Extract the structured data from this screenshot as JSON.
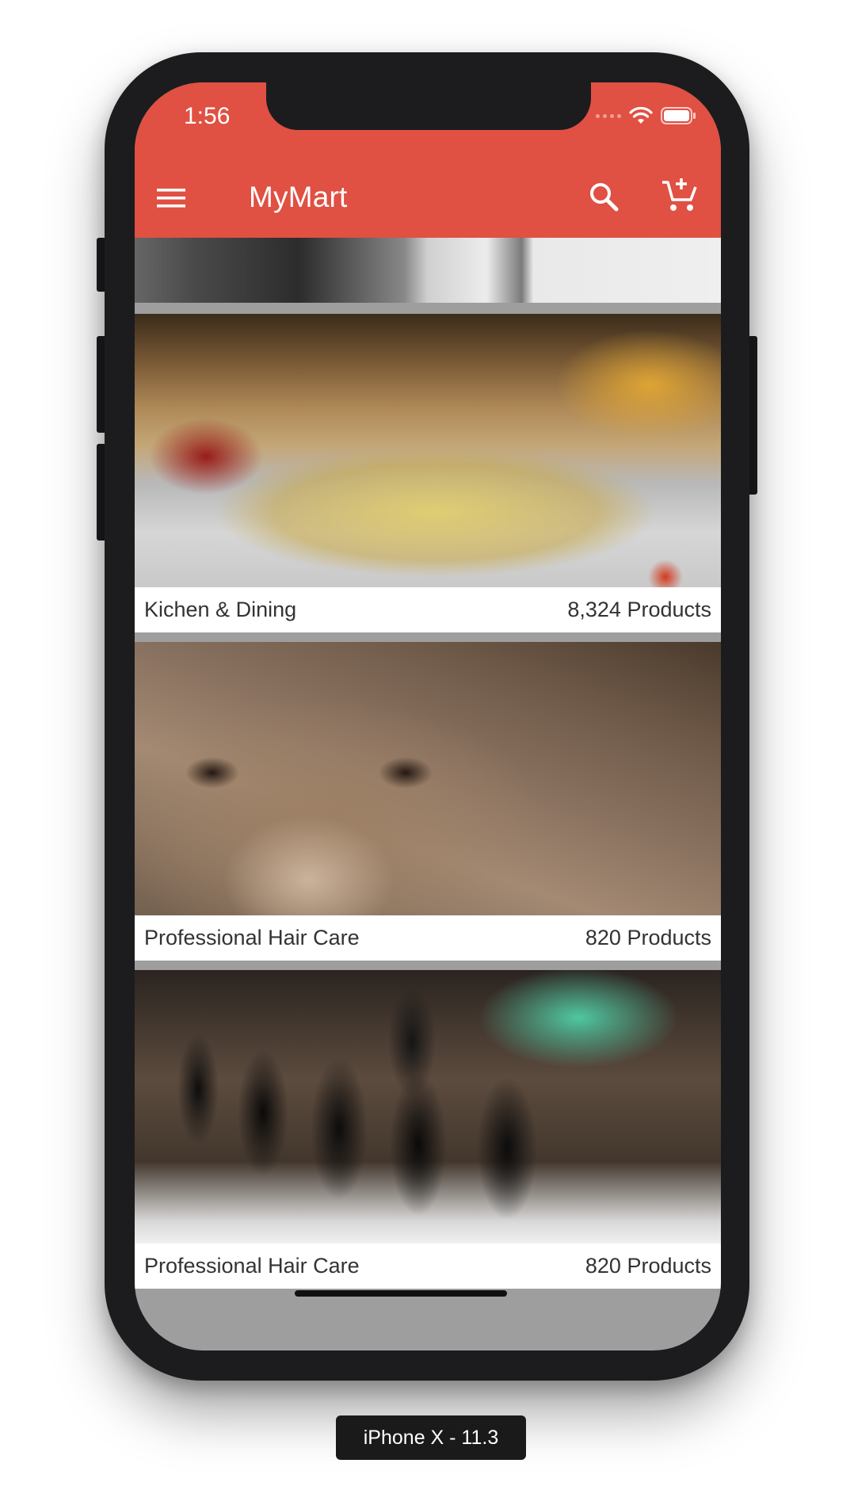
{
  "status_bar": {
    "time": "1:56"
  },
  "toolbar": {
    "title": "MyMart",
    "menu_icon": "hamburger-menu-icon",
    "search_icon": "search-icon",
    "cart_icon": "add-to-cart-icon"
  },
  "colors": {
    "primary": "#e05043",
    "background": "#9e9e9e",
    "card": "#ffffff"
  },
  "categories": [
    {
      "name": "Kichen & Dining",
      "count": "8,324 Products"
    },
    {
      "name": "Professional Hair Care",
      "count": "820 Products"
    },
    {
      "name": "Professional Hair Care",
      "count": "820 Products"
    }
  ],
  "device_label": "iPhone X - 11.3"
}
